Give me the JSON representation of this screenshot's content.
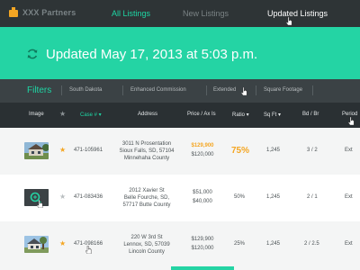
{
  "nav": {
    "logo_text": "XXX Partners",
    "tabs": [
      {
        "label": "All Listings"
      },
      {
        "label": "New Listings"
      },
      {
        "label": "Updated Listings"
      }
    ]
  },
  "banner": {
    "title": "Updated May 17, 2013 at 5:03 p.m."
  },
  "filters": {
    "label": "Filters",
    "items": [
      {
        "label": "South Dakota"
      },
      {
        "label": "Enhanced Commission"
      },
      {
        "label": "Extended"
      },
      {
        "label": "Square Footage"
      }
    ]
  },
  "table": {
    "headers": {
      "image": "Image",
      "case": "Case # ▾",
      "address": "Address",
      "price": "Price / Ax Is",
      "ratio": "Ratio ▾",
      "sqft": "Sq Ft ▾",
      "bdbr": "Bd / Br",
      "period": "Period"
    },
    "rows": [
      {
        "case": "471-105961",
        "address": [
          "3011 N Prosentation",
          "Sioux Falls, SD, 57104",
          "Minnehaha County"
        ],
        "price_a": "$129,900",
        "price_b": "$120,000",
        "ratio": "75%",
        "sqft": "1,245",
        "bdbr": "3 / 2",
        "period": "Ext"
      },
      {
        "case": "471-083436",
        "address": [
          "2012 Xavier St",
          "Belle Fourche, SD,",
          "57717 Butte County"
        ],
        "price_a": "$51,000",
        "price_b": "$40,000",
        "ratio": "50%",
        "sqft": "1,245",
        "bdbr": "2 / 1",
        "period": "Ext"
      },
      {
        "case": "471-098166",
        "address": [
          "220 W 3rd St",
          "Lennox, SD, 57039",
          "Lincoln County"
        ],
        "price_a": "$129,900",
        "price_b": "$120,000",
        "ratio": "25%",
        "sqft": "1,245",
        "bdbr": "2 / 2.5",
        "period": "Ext"
      }
    ]
  },
  "colors": {
    "accent": "#24d4a4",
    "nav_bg": "#2e3436",
    "highlight": "#f4a623"
  }
}
